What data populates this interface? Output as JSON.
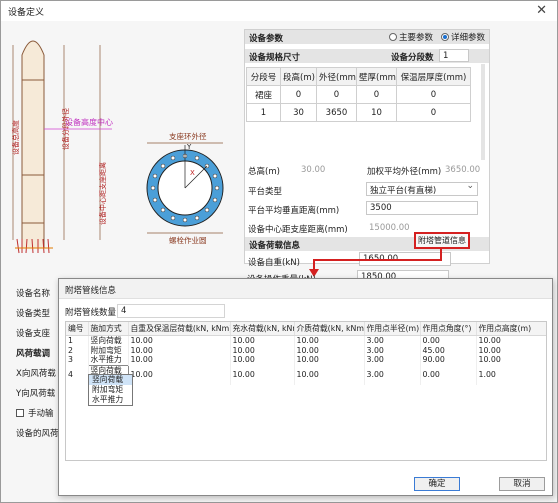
{
  "window": {
    "title": "设备定义"
  },
  "drawing": {
    "labels": {
      "shell_out_d": "设备分段外径",
      "height_center": "设备高度中心",
      "support_ring": "支座环外径",
      "bolt_circle": "螺栓作业圆",
      "platform_dist": "设备中心距支座距离",
      "skirt_h": "设备总高度",
      "pos_label": "Y",
      "pos_label2": "X"
    }
  },
  "params": {
    "title": "设备参数",
    "radio_main": "主要参数",
    "radio_detail": "详细参数",
    "size_title": "设备规格尺寸",
    "seg_count_label": "设备分段数",
    "seg_count": "1",
    "columns": [
      "分段号",
      "段高(m)",
      "外径(mm)",
      "壁厚(mm)",
      "保温层厚度(mm)"
    ],
    "rows": [
      [
        "裙座",
        "0",
        "0",
        "0",
        "0"
      ],
      [
        "1",
        "30",
        "3650",
        "10",
        "0"
      ]
    ],
    "total_h_label": "总高(m)",
    "total_h": "30.00",
    "avg_d_label": "加权平均外径(mm)",
    "avg_d": "3650.00",
    "platform_type_label": "平台类型",
    "platform_type": "独立平台(有直梯)",
    "platform_dist_label": "平台平均垂直距离(mm)",
    "platform_dist": "3500",
    "center_dist_label": "设备中心距支座距离(mm)",
    "center_dist": "15000.00",
    "load_title": "设备荷载信息",
    "attach_btn": "附塔管道信息",
    "self_weight_label": "设备自重(kN)",
    "self_weight": "1650.00",
    "op_weight_label": "设备操作重量(kN)",
    "op_weight": "1850.00"
  },
  "left_labels": {
    "name": "设备名称",
    "type": "设备类型",
    "support": "设备支座",
    "wind": "风荷载调",
    "x_wind": "X向风荷载",
    "y_wind": "Y向风荷载",
    "manual": "手动输",
    "wind_note": "设备的风荷"
  },
  "dialog": {
    "title": "附塔管线信息",
    "count_label": "附塔管线数量",
    "count": "4",
    "columns": [
      "编号",
      "施加方式",
      "自重及保温层荷载(kN, kNm)",
      "充水荷载(kN, kNm)",
      "介质荷载(kN, kNm)",
      "作用点半径(m)",
      "作用点角度(°)",
      "作用点高度(m)"
    ],
    "rows": [
      [
        "1",
        "竖向荷载",
        "10.00",
        "10.00",
        "10.00",
        "3.00",
        "0.00",
        "10.00"
      ],
      [
        "2",
        "附加弯矩",
        "10.00",
        "10.00",
        "10.00",
        "3.00",
        "45.00",
        "10.00"
      ],
      [
        "3",
        "水平推力",
        "10.00",
        "10.00",
        "10.00",
        "3.00",
        "90.00",
        "10.00"
      ],
      [
        "4",
        "竖向荷载",
        "10.00",
        "10.00",
        "10.00",
        "3.00",
        "0.00",
        "1.00"
      ]
    ],
    "dropdown_options": [
      "竖向荷载",
      "附加弯矩",
      "水平推力"
    ],
    "ok": "确定",
    "cancel": "取消"
  }
}
